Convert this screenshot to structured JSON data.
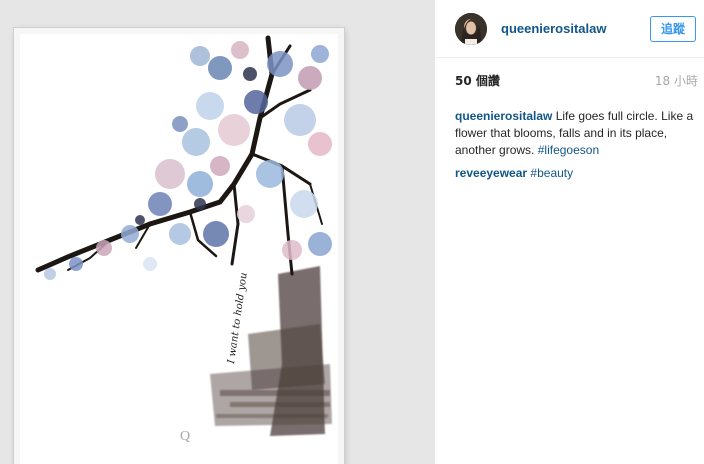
{
  "post": {
    "username": "queenierositalaw",
    "follow_label": "追蹤",
    "views": "50 個讚",
    "time": "18 小時",
    "caption": {
      "user": "queenierositalaw",
      "text": "Life goes full circle. Like a flower that blooms, falls and in its place, another grows.",
      "tag": "#lifegoeson"
    },
    "comment": {
      "user": "reveeyewear",
      "tag": "#beauty"
    },
    "artwork": {
      "script_text": "I want to hold you",
      "monogram": "Q"
    }
  },
  "colors": {
    "link": "#125688",
    "follow": "#3897f0",
    "muted": "#a5a7aa"
  }
}
